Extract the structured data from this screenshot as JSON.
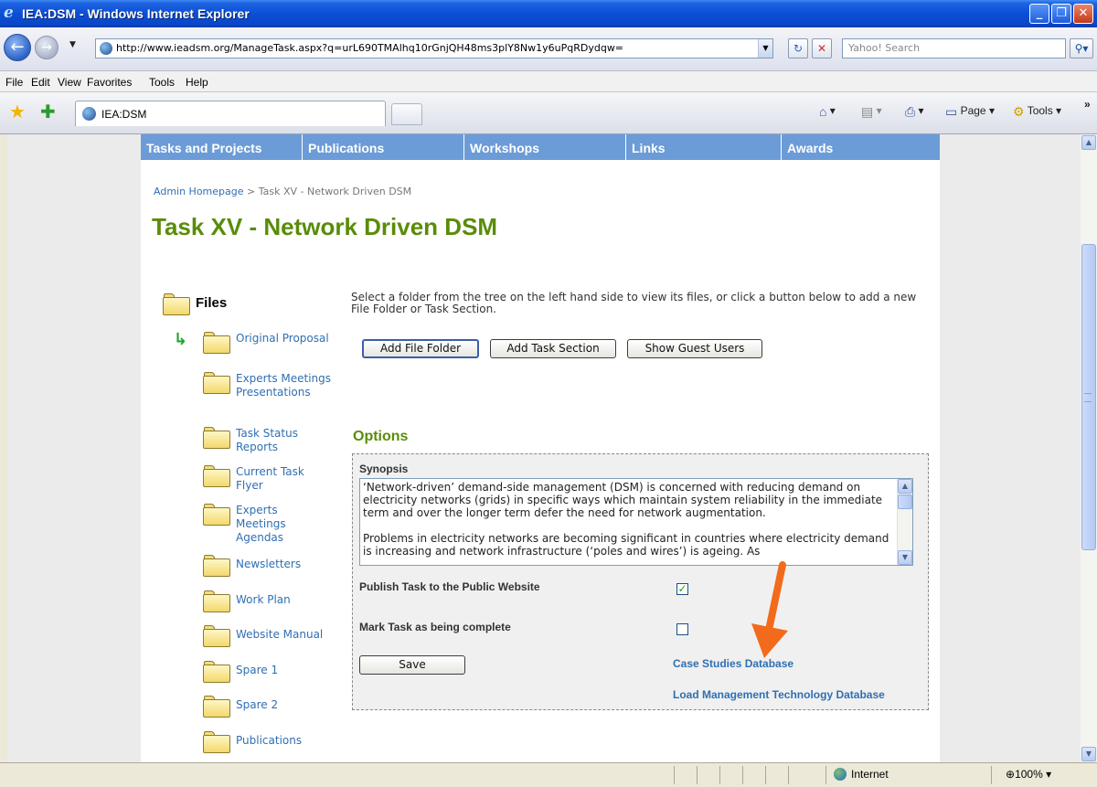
{
  "window": {
    "title": "IEA:DSM - Windows Internet Explorer",
    "minimize_label": "_",
    "maximize_label": "❐",
    "close_label": "✕"
  },
  "address_bar": {
    "url": "http://www.ieadsm.org/ManageTask.aspx?q=urL690TMAlhq10rGnjQH48ms3plY8Nw1y6uPqRDydqw=",
    "search_placeholder": "Yahoo! Search"
  },
  "menu": [
    "File",
    "Edit",
    "View",
    "Favorites",
    "Tools",
    "Help"
  ],
  "tab": {
    "label": "IEA:DSM"
  },
  "commands": {
    "page_label": "Page",
    "tools_label": "Tools"
  },
  "site_nav": [
    "Tasks and Projects",
    "Publications",
    "Workshops",
    "Links",
    "Awards"
  ],
  "breadcrumb": {
    "home": "Admin Homepage",
    "separator": ">",
    "current": "Task XV - Network Driven DSM"
  },
  "page_title": "Task XV - Network Driven DSM",
  "files": {
    "title": "Files",
    "folders": [
      "Original Proposal",
      "Experts Meetings Presentations",
      "Task Status Reports",
      "Current Task Flyer",
      "Experts Meetings Agendas",
      "Newsletters",
      "Work Plan",
      "Website Manual",
      "Spare 1",
      "Spare 2",
      "Publications"
    ]
  },
  "intro_text": "Select a folder from the tree on the left hand side to view its files, or click a button below to add a new File Folder or Task Section.",
  "buttons": {
    "add_file_folder": "Add File Folder",
    "add_task_section": "Add Task Section",
    "show_guest_users": "Show Guest Users",
    "save": "Save"
  },
  "options": {
    "title": "Options",
    "synopsis_label": "Synopsis",
    "synopsis_p1": "‘Network-driven’ demand-side management (DSM) is concerned with reducing demand on electricity networks (grids) in specific ways which maintain system reliability in the immediate term and over the longer term defer the need for network augmentation.",
    "synopsis_p2": "Problems in electricity networks are becoming significant in countries where electricity demand is increasing and network infrastructure (‘poles and wires’) is ageing. As",
    "publish_label": "Publish Task to the Public Website",
    "publish_checked": true,
    "complete_label": "Mark Task as being complete",
    "complete_checked": false,
    "case_studies_link": "Case Studies Database",
    "load_mgmt_link": "Load Management Technology Database"
  },
  "status_bar": {
    "zone": "Internet",
    "zoom": "100%"
  },
  "colors": {
    "title_green": "#5a8c0a",
    "nav_blue": "#6b9cd7",
    "link_blue": "#2f6fb3",
    "arrow_orange": "#f26b1d"
  }
}
